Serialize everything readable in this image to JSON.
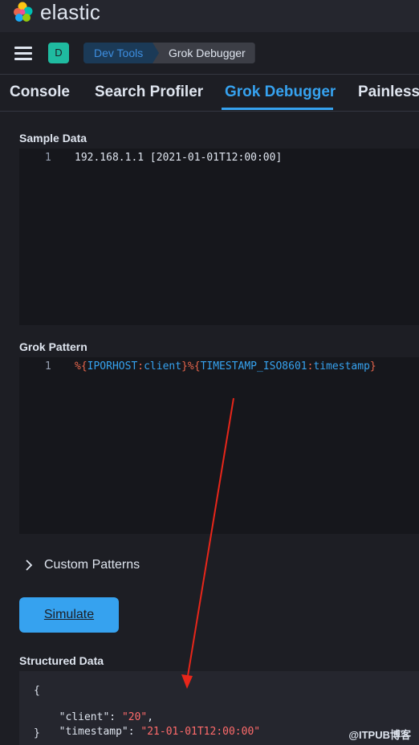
{
  "header": {
    "brand": "elastic",
    "avatar_letter": "D"
  },
  "breadcrumbs": [
    "Dev Tools",
    "Grok Debugger"
  ],
  "tabs": [
    "Console",
    "Search Profiler",
    "Grok Debugger",
    "Painless"
  ],
  "active_tab": "Grok Debugger",
  "sample_data": {
    "label": "Sample Data",
    "line_number": "1",
    "text": "192.168.1.1 [2021-01-01T12:00:00]"
  },
  "grok_pattern": {
    "label": "Grok Pattern",
    "line_number": "1",
    "tokens": [
      {
        "t": "%{",
        "c": "#e7664c"
      },
      {
        "t": "IPORHOST",
        "c": "#36a2ef"
      },
      {
        "t": ":",
        "c": "#e7664c"
      },
      {
        "t": "client",
        "c": "#36a2ef"
      },
      {
        "t": "}",
        "c": "#e7664c"
      },
      {
        "t": "%{",
        "c": "#e7664c"
      },
      {
        "t": "TIMESTAMP_ISO8601",
        "c": "#36a2ef"
      },
      {
        "t": ":",
        "c": "#e7664c"
      },
      {
        "t": "timestamp",
        "c": "#36a2ef"
      },
      {
        "t": "}",
        "c": "#e7664c"
      }
    ]
  },
  "custom_patterns": {
    "label": "Custom Patterns"
  },
  "simulate_button": {
    "label": "Simulate"
  },
  "structured_data": {
    "label": "Structured Data",
    "open_brace": "{",
    "close_brace": "}",
    "fields": [
      {
        "key": "\"client\"",
        "value": "\"20\"",
        "trail": ","
      },
      {
        "key": "\"timestamp\"",
        "value": "\"21-01-01T12:00:00\"",
        "trail": ""
      }
    ]
  },
  "watermark": "@ITPUB博客",
  "colors": {
    "accent": "#36a2ef",
    "string": "#f66",
    "annotation_arrow": "#e8261a"
  }
}
